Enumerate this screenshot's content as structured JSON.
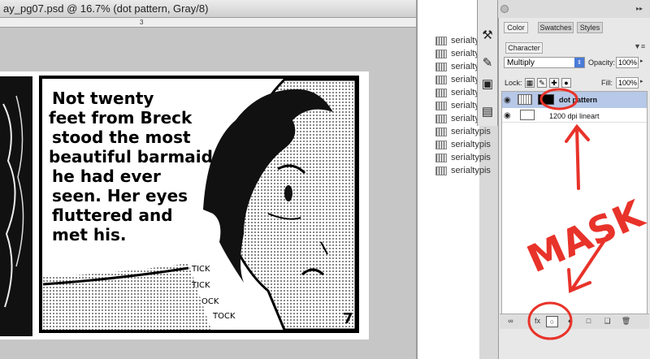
{
  "document": {
    "title": "ay_pg07.psd @ 16.7% (dot pattern, Gray/8)",
    "ruler_mark": "3"
  },
  "comic": {
    "caption_lines": [
      "Not twenty",
      "feet from Breck",
      "stood the most",
      "beautiful barmaid",
      "he had ever",
      "seen.  Her eyes",
      "fluttered and",
      "met his."
    ],
    "sfx_lines": [
      "TICK",
      "TICK",
      "OCK",
      "TOCK"
    ],
    "page_number": "7"
  },
  "layers_bg": {
    "items": [
      "serialty",
      "serialty",
      "serialty",
      "serialty",
      "serialty",
      "serialty",
      "serialtypis",
      "serialtypis",
      "serialtypis",
      "serialtypis",
      "serialtypis"
    ]
  },
  "tools": [
    "crossed-tools-icon",
    "brush-tool-icon",
    "clone-stamp-icon",
    "notes-icon"
  ],
  "panel": {
    "tabs": [
      "Color",
      "Swatches",
      "Styles"
    ],
    "character_tab": "Character",
    "blend_mode": "Multiply",
    "opacity_label": "Opacity:",
    "opacity_value": "100%",
    "lock_label": "Lock:",
    "fill_label": "Fill:",
    "fill_value": "100%",
    "layers": [
      {
        "name": "dot pattern",
        "selected": true
      },
      {
        "name": "1200 dpi lineart",
        "selected": false
      }
    ]
  },
  "annotation": {
    "text": "MASK",
    "color": "#e8332a"
  }
}
